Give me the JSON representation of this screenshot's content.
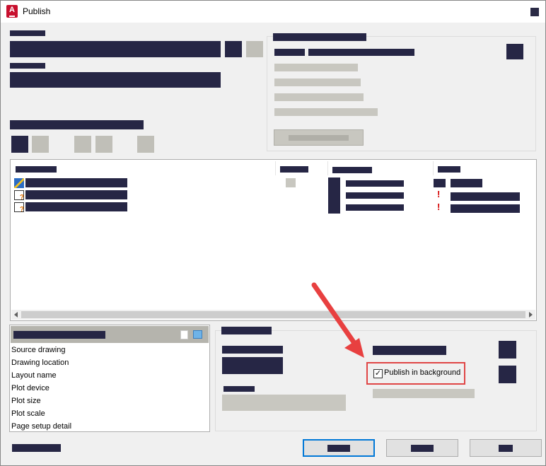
{
  "window": {
    "title": "Publish",
    "icon_letter": "A"
  },
  "details_list": {
    "items": [
      "Source drawing",
      "Drawing location",
      "Layout name",
      "Plot device",
      "Plot size",
      "Plot scale",
      "Page setup detail"
    ]
  },
  "publish_options": {
    "background_checkbox_label": "Publish in background",
    "background_checked": true
  },
  "sheets": [
    {
      "status_icon": "sheet-ok-icon",
      "warning": false
    },
    {
      "status_icon": "sheet-missing-icon",
      "warning": true
    },
    {
      "status_icon": "sheet-missing-icon",
      "warning": true
    }
  ],
  "colors": {
    "accent": "#0078d7",
    "highlight": "#e04545",
    "redacted": "#262645"
  }
}
